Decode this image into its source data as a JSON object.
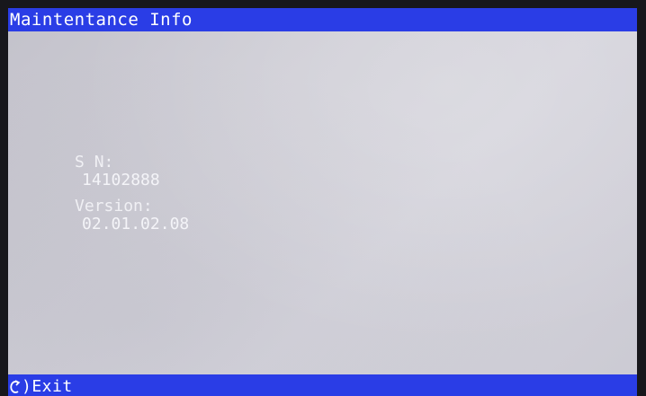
{
  "window": {
    "title": "Maintentance Info"
  },
  "info": {
    "serial_label": "S N:",
    "serial_value": "14102888",
    "version_label": "Version:",
    "version_value": "02.01.02.08"
  },
  "footer": {
    "exit_icon": "return-arrow-icon",
    "exit_label": ")Exit"
  },
  "colors": {
    "bar": "#2a3de6",
    "screen": "#cfced6",
    "text": "#ffffff"
  }
}
